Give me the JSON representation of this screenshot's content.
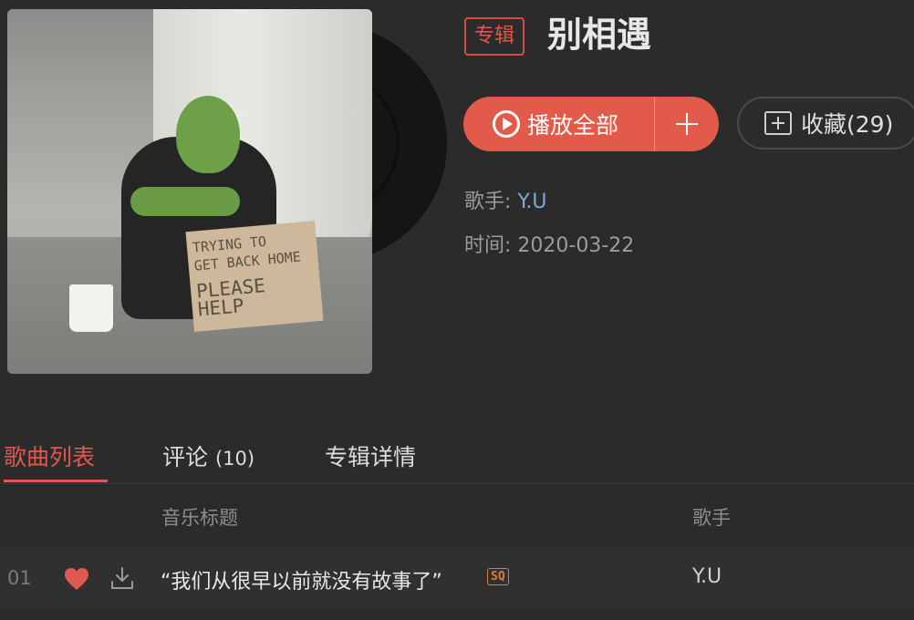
{
  "album": {
    "badge": "专辑",
    "title": "别相遇",
    "cover_sign_lines": [
      "TRYING TO",
      "GET BACK HOME",
      "PLEASE HELP"
    ]
  },
  "actions": {
    "play_all_label": "播放全部",
    "collect_label": "收藏(29)"
  },
  "meta": {
    "artist_label": "歌手:",
    "artist_value": "Y.U",
    "time_label": "时间:",
    "time_value": "2020-03-22"
  },
  "tabs": {
    "songs": "歌曲列表",
    "comments": "评论",
    "comments_count": "(10)",
    "details": "专辑详情"
  },
  "table": {
    "col_title": "音乐标题",
    "col_artist": "歌手",
    "rows": [
      {
        "num": "01",
        "title": "“我们从很早以前就没有故事了”",
        "quality": "SQ",
        "artist": "Y.U"
      }
    ]
  },
  "colors": {
    "accent": "#e2574f",
    "link": "#7ea7d8",
    "background": "#2b2b2b",
    "sq_badge": "#e07c35"
  }
}
